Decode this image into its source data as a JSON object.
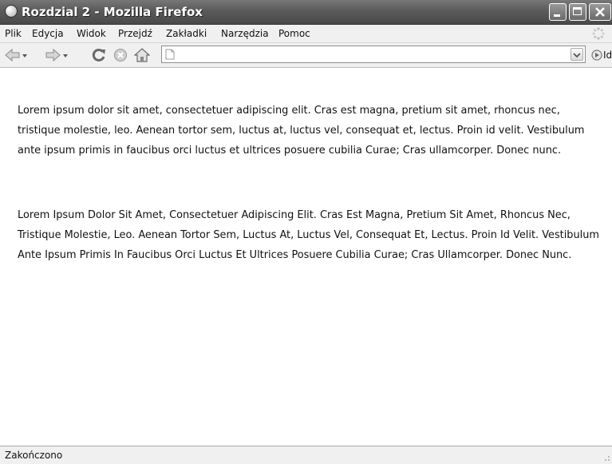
{
  "window": {
    "title": "Rozdzial 2 - Mozilla Firefox"
  },
  "menu": {
    "items": [
      "Plik",
      "Edycja",
      "Widok",
      "Przejdź",
      "Zakładki",
      "Narzędzia",
      "Pomoc"
    ]
  },
  "toolbar": {
    "icons": [
      "back-icon",
      "forward-icon",
      "reload-icon",
      "stop-icon",
      "home-icon"
    ],
    "address_value": "",
    "go_label": "Idź"
  },
  "content": {
    "paragraph1": "Lorem ipsum dolor sit amet, consectetuer adipiscing elit. Cras est magna, pretium sit amet, rhoncus nec, tristique molestie, leo. Aenean tortor sem, luctus at, luctus vel, consequat et, lectus. Proin id velit. Vestibulum ante ipsum primis in faucibus orci luctus et ultrices posuere cubilia Curae; Cras ullamcorper. Donec nunc.",
    "paragraph2": "Lorem Ipsum Dolor Sit Amet, Consectetuer Adipiscing Elit. Cras Est Magna, Pretium Sit Amet, Rhoncus Nec, Tristique Molestie, Leo. Aenean Tortor Sem, Luctus At, Luctus Vel, Consequat Et, Lectus. Proin Id Velit. Vestibulum Ante Ipsum Primis In Faucibus Orci Luctus Et Ultrices Posuere Cubilia Curae; Cras Ullamcorper. Donec Nunc."
  },
  "status": {
    "text": "Zakończono"
  }
}
